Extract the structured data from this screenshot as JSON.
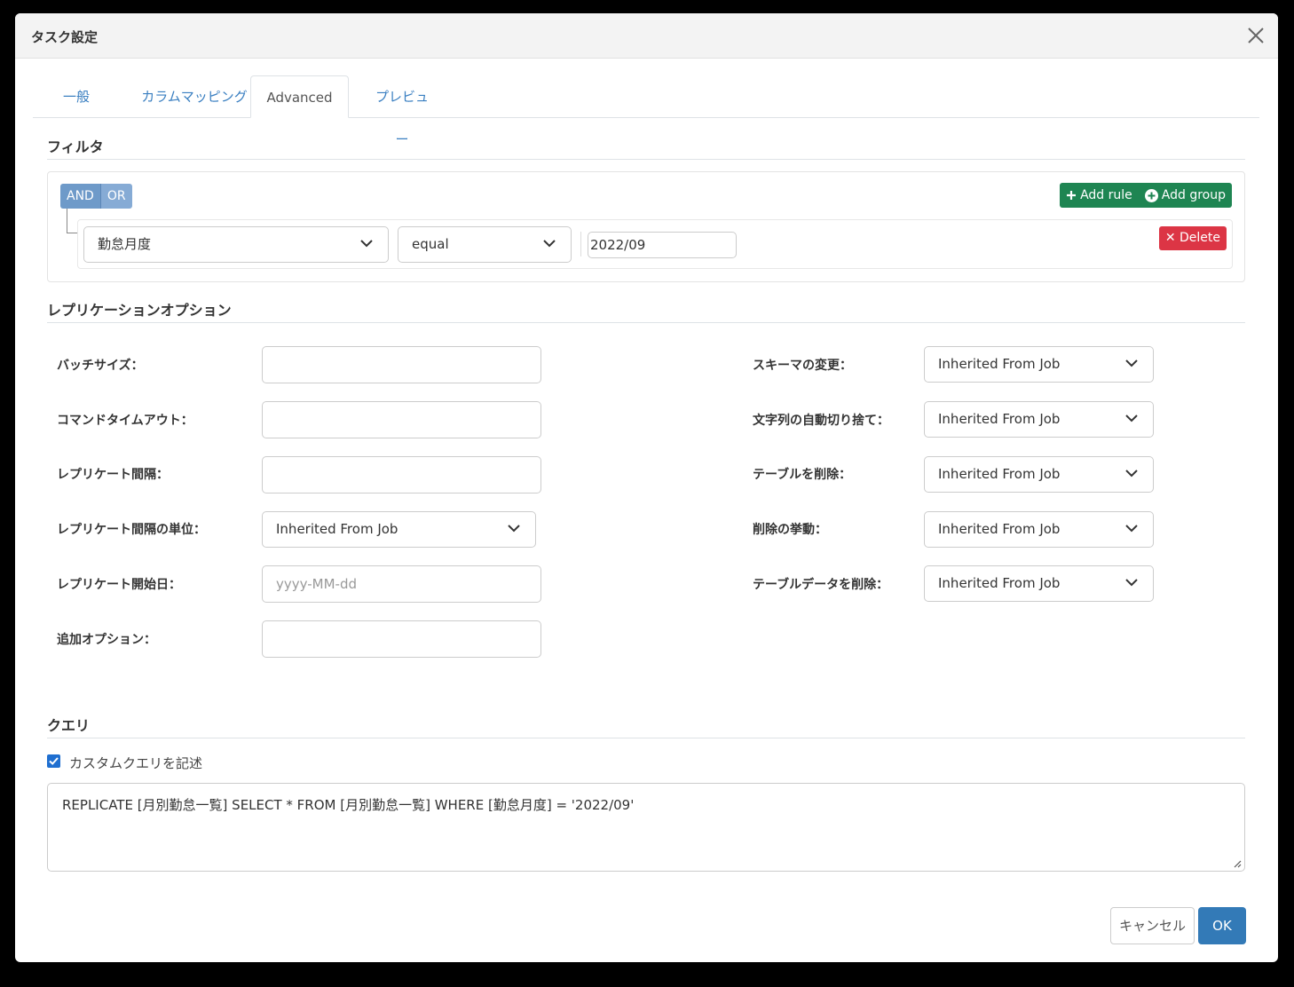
{
  "dialog": {
    "title": "タスク設定"
  },
  "tabs": [
    {
      "label": "一般"
    },
    {
      "label": "カラムマッピング"
    },
    {
      "label": "Advanced"
    },
    {
      "label": "プレビュー"
    }
  ],
  "active_tab": "Advanced",
  "filter": {
    "section_title": "フィルタ",
    "and_label": "AND",
    "or_label": "OR",
    "add_rule_label": "Add rule",
    "add_group_label": "Add group",
    "rule": {
      "field": "勤怠月度",
      "operator": "equal",
      "value": "2022/09",
      "delete_label": "Delete"
    }
  },
  "replication": {
    "section_title": "レプリケーションオプション",
    "left": [
      {
        "label": "バッチサイズ：",
        "value": ""
      },
      {
        "label": "コマンドタイムアウト：",
        "value": ""
      },
      {
        "label": "レプリケート間隔：",
        "value": ""
      },
      {
        "label": "レプリケート間隔の単位：",
        "value": "Inherited From Job"
      },
      {
        "label": "レプリケート開始日：",
        "placeholder": "yyyy-MM-dd"
      },
      {
        "label": "追加オプション：",
        "value": ""
      }
    ],
    "right": [
      {
        "label": "スキーマの変更：",
        "value": "Inherited From Job"
      },
      {
        "label": "文字列の自動切り捨て：",
        "value": "Inherited From Job"
      },
      {
        "label": "テーブルを削除：",
        "value": "Inherited From Job"
      },
      {
        "label": "削除の挙動：",
        "value": "Inherited From Job"
      },
      {
        "label": "テーブルデータを削除：",
        "value": "Inherited From Job"
      }
    ]
  },
  "query": {
    "section_title": "クエリ",
    "checkbox_label": "カスタムクエリを記述",
    "checked": true,
    "text": "REPLICATE [月別勤怠一覧] SELECT * FROM [月別勤怠一覧] WHERE [勤怠月度] = '2022/09'"
  },
  "footer": {
    "cancel_label": "キャンセル",
    "ok_label": "OK"
  },
  "colors": {
    "primary": "#337ab7",
    "success": "#1e8552",
    "danger": "#dc3545",
    "tab_link": "#3a7fc1"
  }
}
